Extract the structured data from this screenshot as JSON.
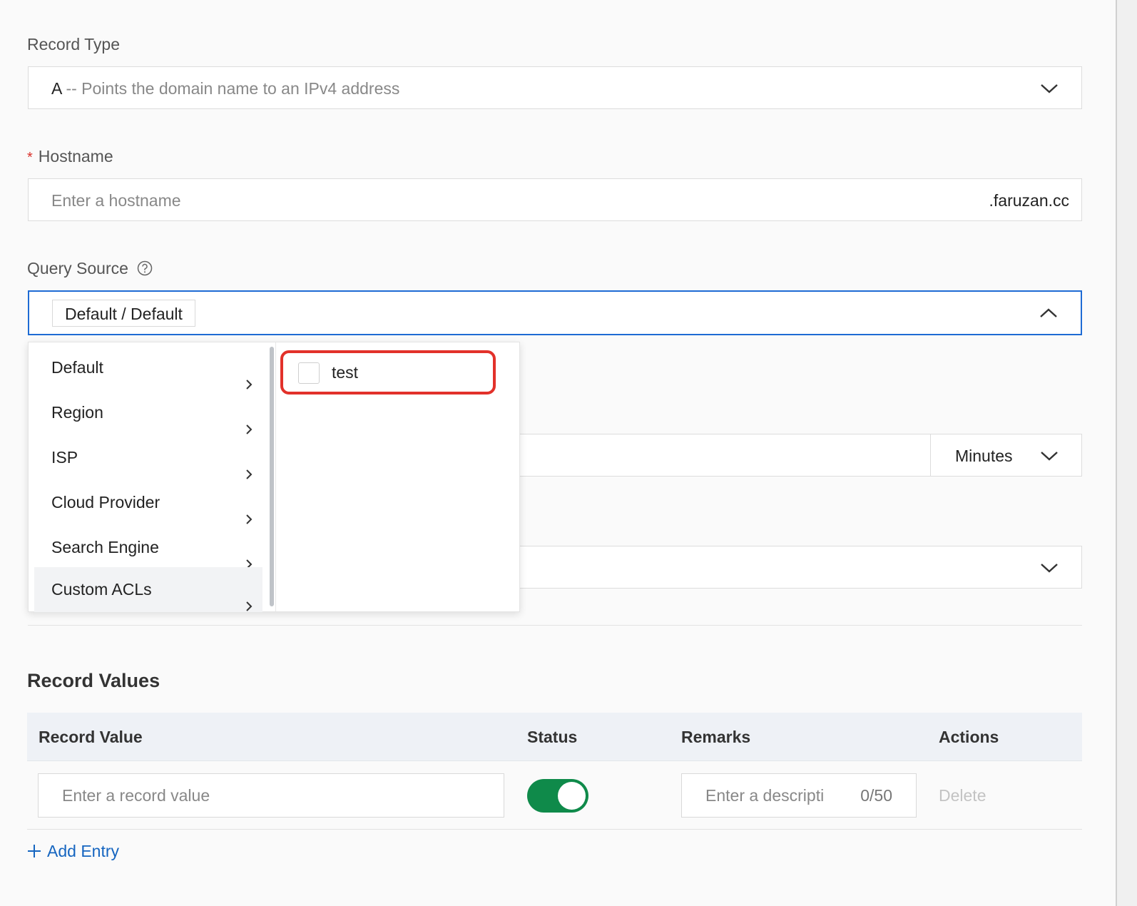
{
  "record_type": {
    "label": "Record Type",
    "value_main": "A",
    "value_desc": " -- Points the domain name to an IPv4 address"
  },
  "hostname": {
    "required_mark": "*",
    "label": "Hostname",
    "placeholder": "Enter a hostname",
    "suffix": ".faruzan.cc"
  },
  "query_source": {
    "label": "Query Source",
    "help_icon": "question-circle-icon",
    "selected_tag": "Default / Default"
  },
  "dropdown": {
    "categories": [
      {
        "label": "Default"
      },
      {
        "label": "Region"
      },
      {
        "label": "ISP"
      },
      {
        "label": "Cloud Provider"
      },
      {
        "label": "Search Engine"
      },
      {
        "label": "Custom ACLs"
      }
    ],
    "active_category": "Custom ACLs",
    "options": [
      {
        "label": "test",
        "checked": false
      }
    ]
  },
  "ttl": {
    "unit": "Minutes"
  },
  "record_values": {
    "title": "Record Values",
    "columns": [
      "Record Value",
      "Status",
      "Remarks",
      "Actions"
    ],
    "row": {
      "value_placeholder": "Enter a record value",
      "status_enabled": true,
      "remarks_placeholder": "Enter a descripti",
      "remarks_counter": "0/50",
      "delete_label": "Delete"
    },
    "add_entry_label": "Add Entry"
  },
  "colors": {
    "accent": "#1e6bd4",
    "highlight": "#e2312a",
    "toggle_on": "#0f8a4a",
    "link": "#1565c0"
  }
}
